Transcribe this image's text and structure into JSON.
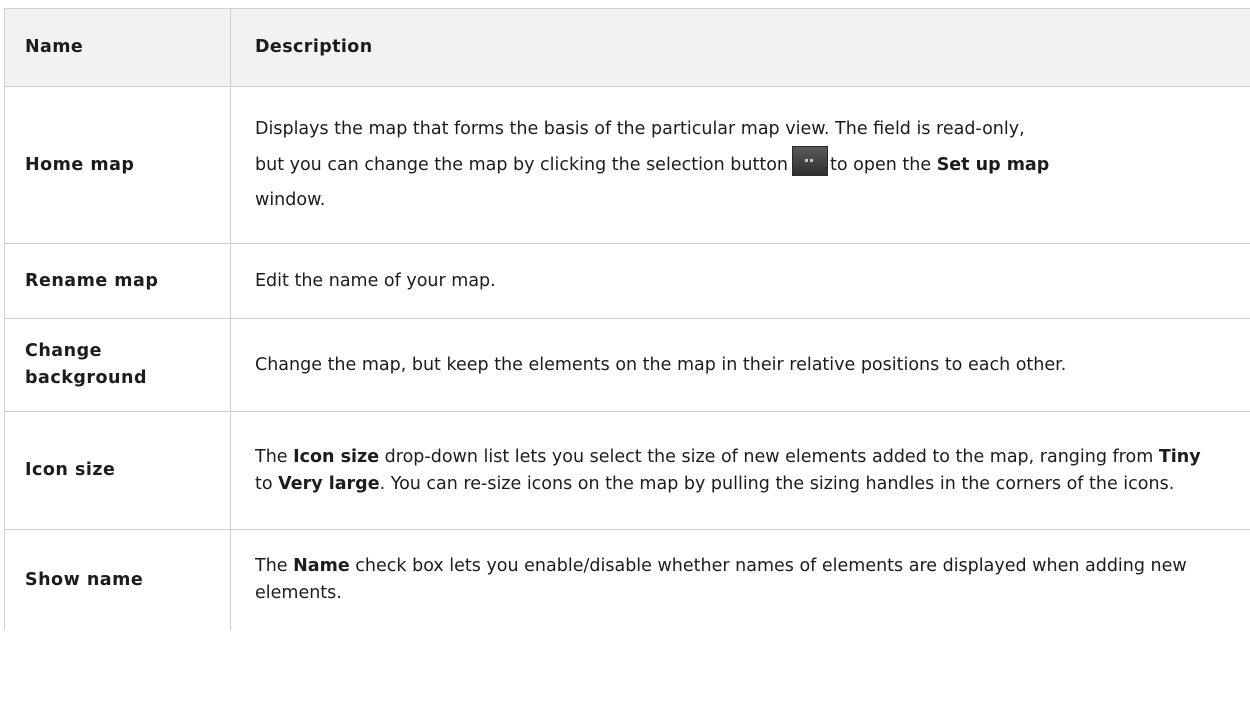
{
  "table": {
    "headers": {
      "name": "Name",
      "description": "Description"
    },
    "rows": [
      {
        "name": "Home map",
        "desc": {
          "p1": "Displays the map that forms the basis of the particular map view. The field is read-only,",
          "p2": "but you can change the map by clicking the selection button",
          "p3": "to open the",
          "b1": "Set up map",
          "p4": "window.",
          "button_icon": "ellipsis-button-icon"
        }
      },
      {
        "name": "Rename map",
        "desc": {
          "p1": "Edit the name of your map."
        }
      },
      {
        "name": "Change background",
        "desc": {
          "p1": "Change the map, but keep the elements on the map in their relative positions to each other."
        }
      },
      {
        "name": "Icon size",
        "desc": {
          "p1": "The",
          "b1": "Icon size",
          "p2": "drop-down list lets you select the size of new elements added to the map, ranging from",
          "b2": "Tiny",
          "p3": "to",
          "b3": "Very large",
          "p4": ". You can re-size icons on the map by pulling the sizing handles in the corners of the icons."
        }
      },
      {
        "name": "Show name",
        "desc": {
          "p1": "The",
          "b1": "Name",
          "p2": "check box lets you enable/disable whether names of elements are displayed when adding new elements."
        }
      }
    ]
  }
}
